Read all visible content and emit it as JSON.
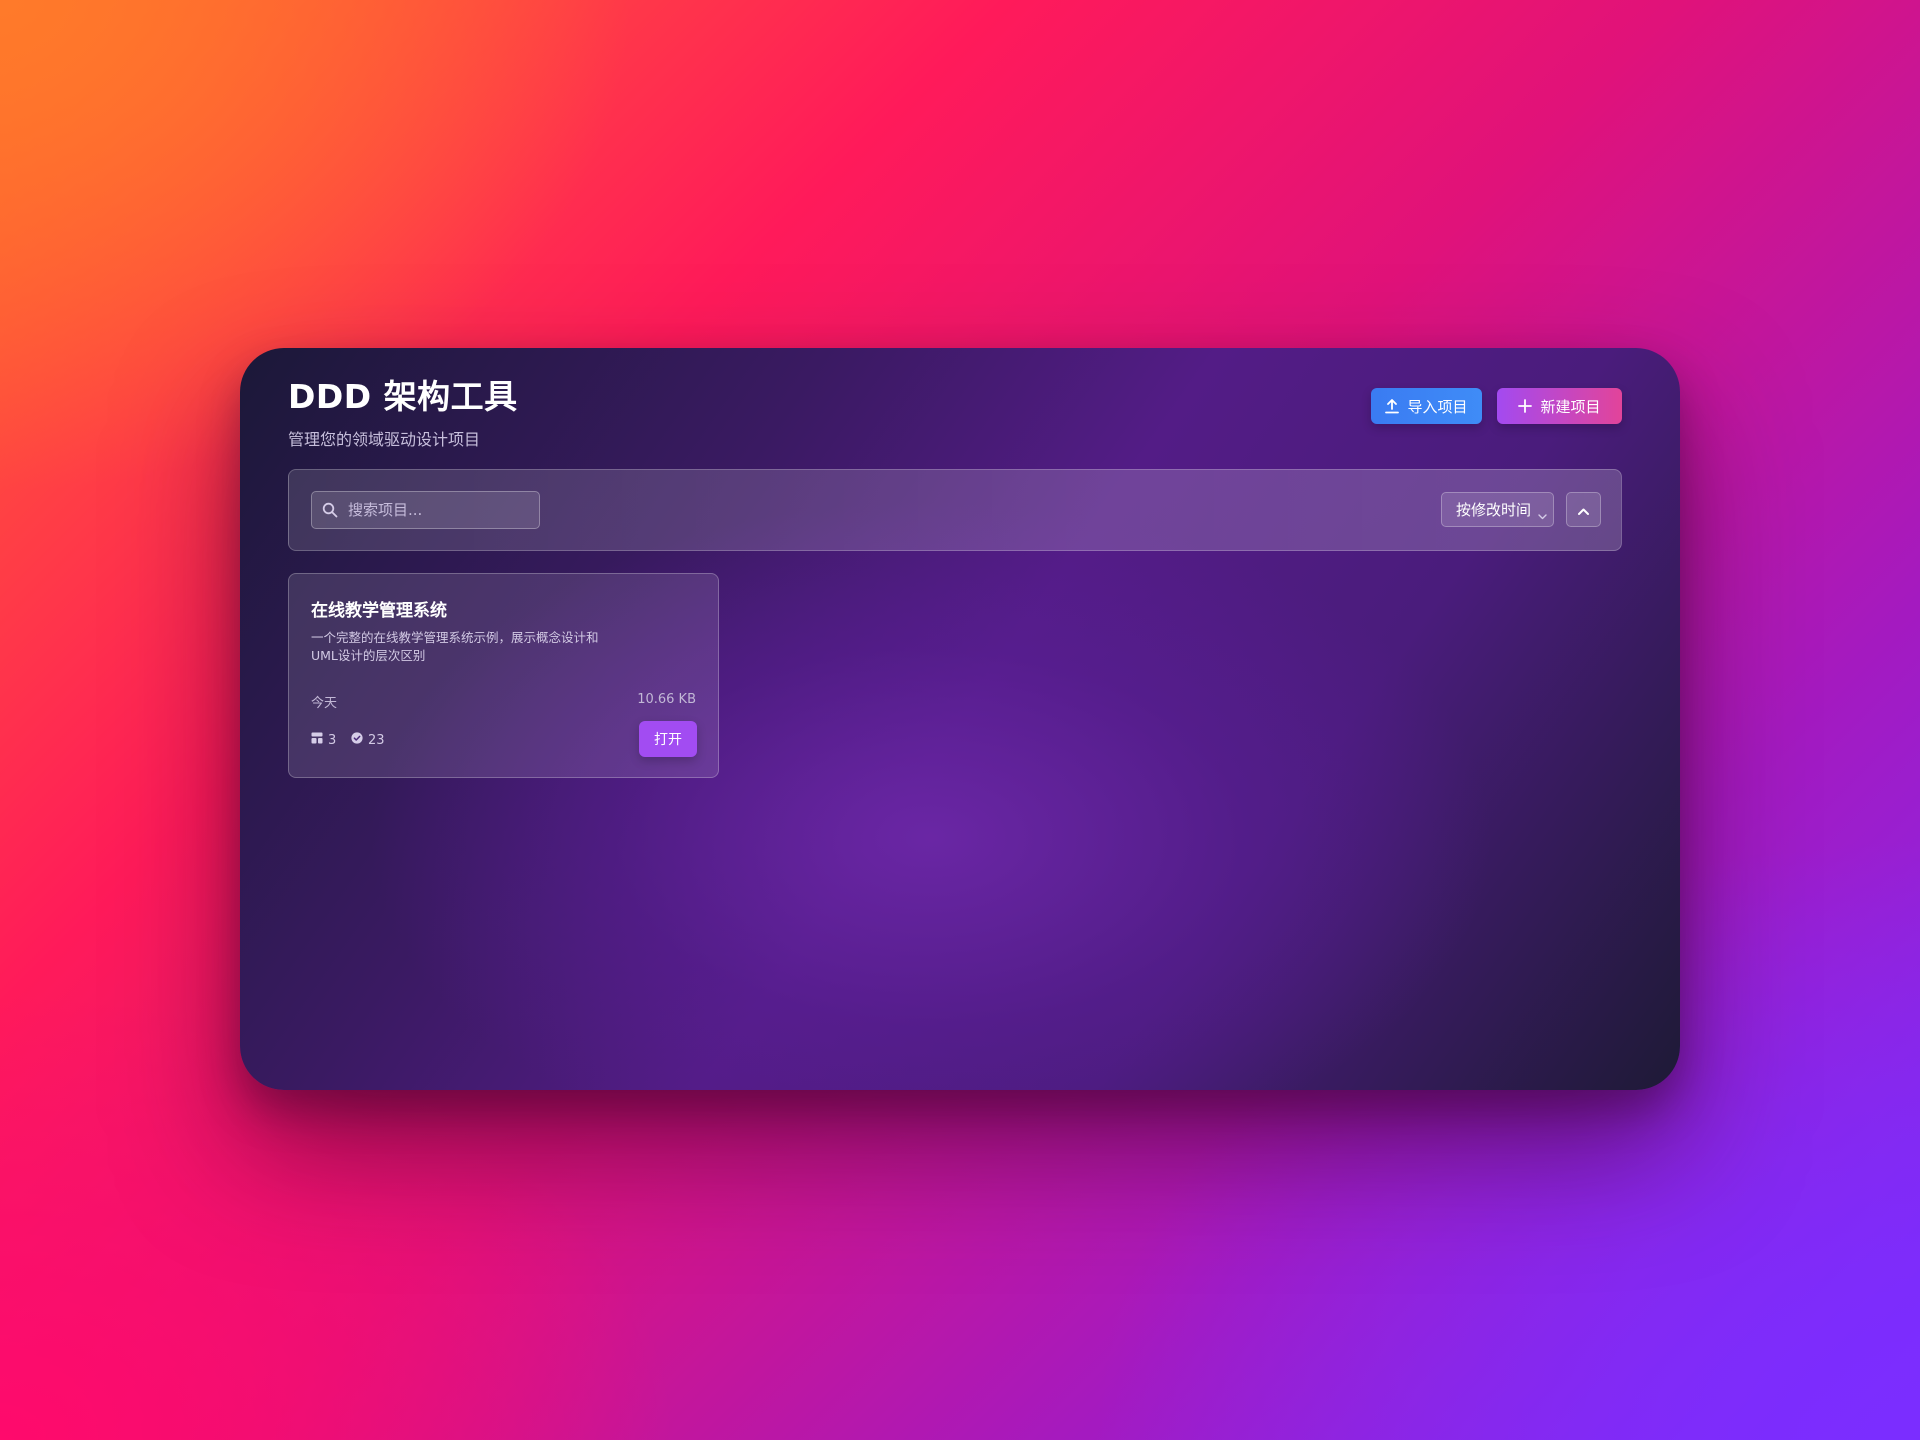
{
  "header": {
    "title": "DDD 架构工具",
    "subtitle": "管理您的领域驱动设计项目",
    "import_label": "导入项目",
    "new_label": "新建项目"
  },
  "toolbar": {
    "search_placeholder": "搜索项目...",
    "search_value": "",
    "sort_selected": "按修改时间",
    "sort_order_icon": "chevron-up-icon"
  },
  "projects": [
    {
      "name": "在线教学管理系统",
      "description": "一个完整的在线教学管理系统示例，展示概念设计和UML设计的层次区别",
      "modified": "今天",
      "size": "10.66 KB",
      "layer_count": "3",
      "item_count": "23",
      "open_label": "打开"
    }
  ],
  "icons": {
    "import": "upload-icon",
    "new": "plus-icon",
    "search": "search-icon",
    "sort": "chevron-down-icon",
    "stat_a": "layout-icon",
    "stat_b": "check-circle-icon"
  },
  "colors": {
    "import_button": "#3b82f6",
    "new_button_start": "#a34af0",
    "new_button_end": "#e2449a",
    "open_button": "#a24cf2"
  }
}
